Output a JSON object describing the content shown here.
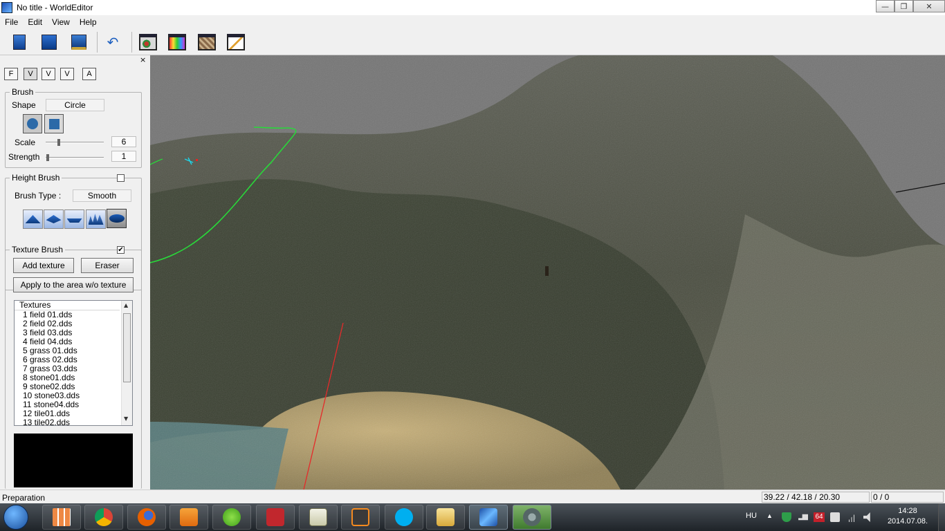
{
  "window": {
    "title": "No title - WorldEditor",
    "controls": [
      "minimize-icon",
      "maximize-icon",
      "close-icon"
    ]
  },
  "menu": [
    "File",
    "Edit",
    "View",
    "Help"
  ],
  "toolbar": {
    "buttons": [
      "new-file-icon",
      "open-folder-icon",
      "save-monitor-icon",
      "undo-icon",
      "object-view-icon",
      "texture-view-icon",
      "map-view-icon",
      "edit-pencil-icon"
    ]
  },
  "panel": {
    "close_glyph": "×",
    "modes": [
      "F",
      "V",
      "V",
      "V",
      "A"
    ],
    "brush": {
      "title": "Brush",
      "shape_label": "Shape",
      "shape_value": "Circle",
      "scale_label": "Scale",
      "scale_value": "6",
      "strength_label": "Strength",
      "strength_value": "1"
    },
    "height_brush": {
      "title": "Height Brush",
      "checked": false,
      "type_label": "Brush Type :",
      "type_value": "Smooth"
    },
    "texture_brush": {
      "title": "Texture Brush",
      "checked": true,
      "check_glyph": "✔",
      "add_label": "Add texture",
      "eraser_label": "Eraser",
      "apply_label": "Apply to the area w/o texture",
      "list_header": "Textures",
      "textures": [
        "1  field 01.dds",
        "2  field 02.dds",
        "3  field 03.dds",
        "4  field 04.dds",
        "5  grass 01.dds",
        "6  grass 02.dds",
        "7  grass 03.dds",
        "8  stone01.dds",
        "9  stone02.dds",
        "10  stone03.dds",
        "11  stone04.dds",
        "12  tile01.dds",
        "13  tile02.dds"
      ]
    }
  },
  "status": {
    "text": "Preparation",
    "coords": "39.22 / 42.18 / 20.30",
    "count": "0 / 0"
  },
  "taskbar": {
    "apps": [
      "start-menu-icon",
      "metro-apps-icon",
      "chrome-icon",
      "firefox-icon",
      "media-player-icon",
      "messenger-icon",
      "filezilla-icon",
      "notepad-icon",
      "sublime-icon",
      "skype-icon",
      "explorer-icon",
      "worldeditor-icon",
      "tortoise-icon"
    ],
    "language": "HU",
    "badge": "64",
    "time": "14:28",
    "date": "2014.07.08."
  }
}
